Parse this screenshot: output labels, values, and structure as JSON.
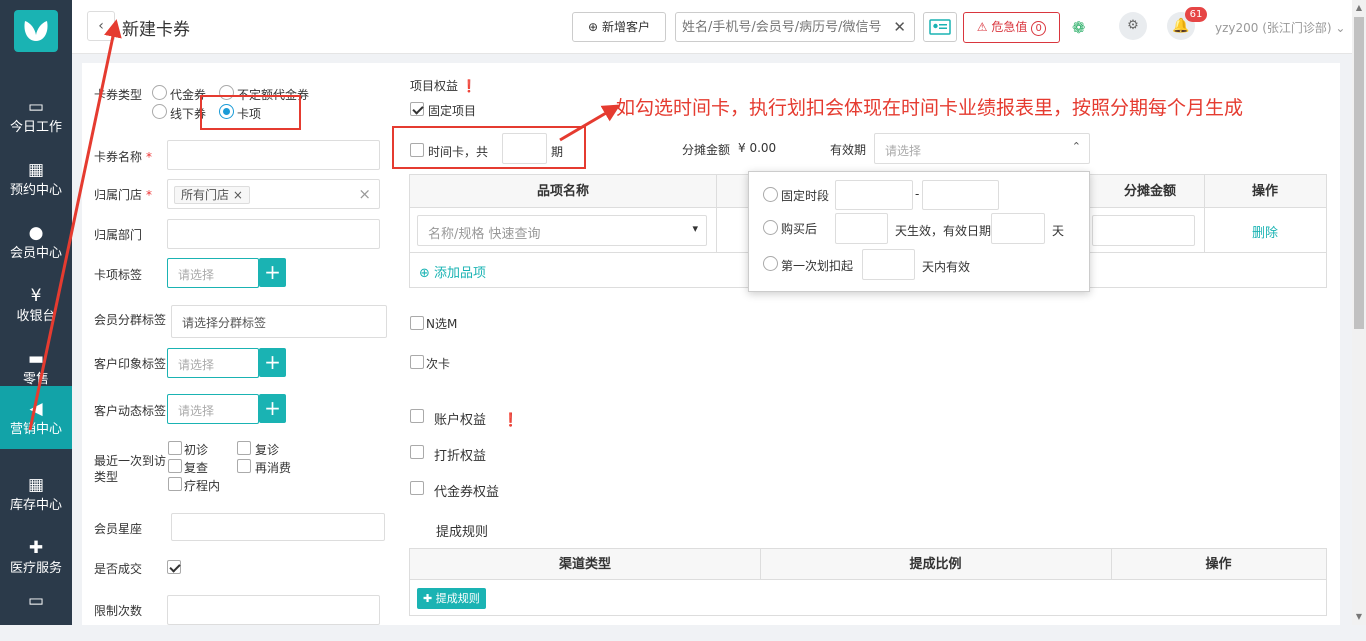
{
  "sidebar": {
    "items": [
      {
        "label": "今日工作",
        "icon": "laptop-icon",
        "glyph": "▭"
      },
      {
        "label": "预约中心",
        "icon": "calendar-icon",
        "glyph": "▦"
      },
      {
        "label": "会员中心",
        "icon": "users-icon",
        "glyph": "●"
      },
      {
        "label": "收银台",
        "icon": "yen-icon",
        "glyph": "¥"
      },
      {
        "label": "零售",
        "icon": "cart-icon",
        "glyph": "▬"
      },
      {
        "label": "营销中心",
        "icon": "megaphone-icon",
        "glyph": "◀"
      },
      {
        "label": "库存中心",
        "icon": "grid-icon",
        "glyph": "▦"
      },
      {
        "label": "医疗服务",
        "icon": "medkit-icon",
        "glyph": "✚"
      },
      {
        "label": "",
        "icon": "more-icon",
        "glyph": "▭"
      }
    ],
    "active_index": 5
  },
  "header": {
    "back_glyph": "‹",
    "title": "新建卡券",
    "add_customer": "新增客户",
    "add_customer_glyph": "⊕",
    "search_placeholder": "姓名/手机号/会员号/病历号/微信号",
    "clear_glyph": "✕",
    "danger_label": "危急值",
    "danger_glyph": "⚠",
    "danger_count": "0",
    "wechat_glyph": "❁",
    "team_glyph": "⚙",
    "bell_glyph": "🔔",
    "notification_count": "61",
    "user": "yzy200 (张江门诊部)",
    "user_caret": "⌄"
  },
  "form": {
    "card_type_label": "卡券类型",
    "card_types": [
      "代金券",
      "不定额代金券",
      "线下券",
      "卡项"
    ],
    "card_type_selected": "卡项",
    "card_name_label": "卡券名称",
    "store_label": "归属门店",
    "store_tag": "所有门店",
    "store_tag_x": "×",
    "store_clear": "×",
    "dept_label": "归属部门",
    "card_tag_label": "卡项标签",
    "select_placeholder": "请选择",
    "plus": "+",
    "group_tag_label": "会员分群标签",
    "group_tag_placeholder": "请选择分群标签",
    "impression_label": "客户印象标签",
    "dynamic_label": "客户动态标签",
    "visit_label_1": "最近一次到访",
    "visit_label_2": "类型",
    "visit_types": [
      "初诊",
      "复诊",
      "复查",
      "再消费",
      "疗程内"
    ],
    "constellation_label": "会员星座",
    "deal_label": "是否成交",
    "deal_checked": true,
    "limit_label": "限制次数",
    "required_mark": "*"
  },
  "rights": {
    "title": "项目权益",
    "info_glyph": "❗",
    "fixed_item": "固定项目",
    "fixed_item_checked": true,
    "time_card_prefix": "时间卡，共",
    "time_card_suffix": "期",
    "share_amount_label": "分摊金额",
    "share_amount_value": "¥ 0.00",
    "validity_label": "有效期",
    "validity_placeholder": "请选择",
    "validity_caret": "⌃",
    "table_headers": [
      "品项名称",
      "",
      "分摊金额",
      "操作"
    ],
    "item_placeholder": "名称/规格 快速查询",
    "item_caret": "▾",
    "delete": "删除",
    "add_item": "添加品项",
    "add_item_glyph": "⊕",
    "n_choose_m": "N选M",
    "count_card": "次卡",
    "account_rights": "账户权益",
    "discount_rights": "打折权益",
    "voucher_rights": "代金券权益",
    "commission_title": "提成规则",
    "commission_headers": [
      "渠道类型",
      "提成比例",
      "操作"
    ],
    "commission_add": "提成规则",
    "commission_add_glyph": "✚"
  },
  "validity_popup": {
    "fixed_period": "固定时段",
    "dash": "-",
    "after_purchase": "购买后",
    "effective_text": "天生效，有效日期",
    "days": "天",
    "first_deduct": "第一次划扣起",
    "valid_within": "天内有效"
  },
  "annotation": {
    "text": "如勾选时间卡，执行划扣会体现在时间卡业绩报表里，按照分期每个月生成",
    "color": "#e53b30"
  },
  "colors": {
    "sidebar_bg": "#2b3a4a",
    "accent": "#1ab3b3",
    "danger": "#d9363e",
    "radio_selected": "#1a9bd7"
  }
}
